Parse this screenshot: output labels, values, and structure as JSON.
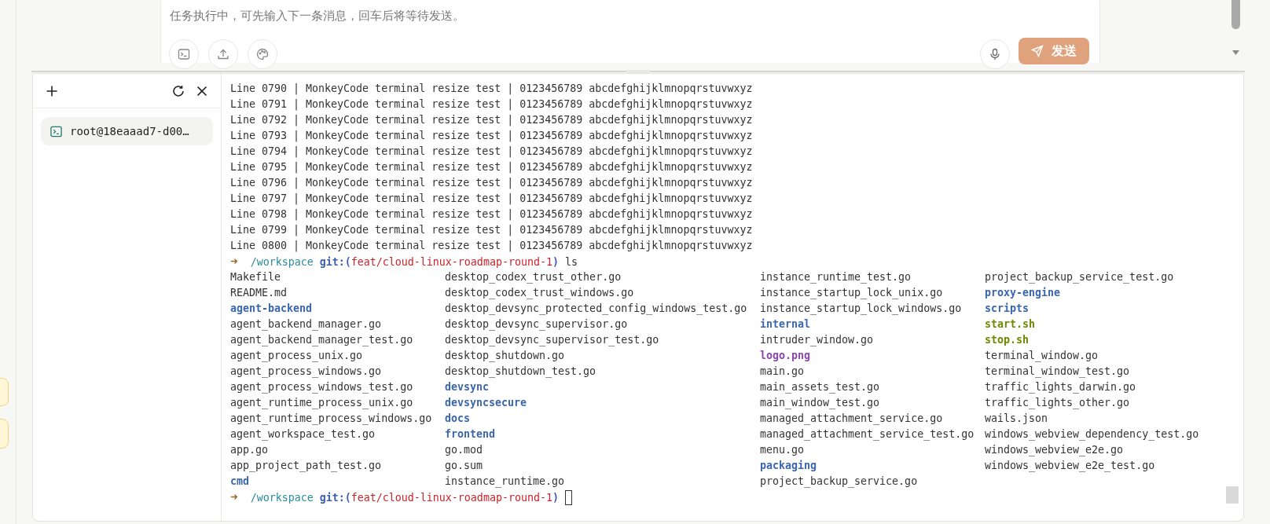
{
  "composer": {
    "placeholder": "任务执行中，可先输入下一条消息，回车后将等待发送。",
    "send_button": "发送"
  },
  "terminal": {
    "sessions": [
      {
        "label": "root@18eaaad7-d00…",
        "selected": true
      }
    ],
    "lines": [
      {
        "kind": "output",
        "text": "Line 0790 | MonkeyCode terminal resize test | 0123456789 abcdefghijklmnopqrstuvwxyz"
      },
      {
        "kind": "output",
        "text": "Line 0791 | MonkeyCode terminal resize test | 0123456789 abcdefghijklmnopqrstuvwxyz"
      },
      {
        "kind": "output",
        "text": "Line 0792 | MonkeyCode terminal resize test | 0123456789 abcdefghijklmnopqrstuvwxyz"
      },
      {
        "kind": "output",
        "text": "Line 0793 | MonkeyCode terminal resize test | 0123456789 abcdefghijklmnopqrstuvwxyz"
      },
      {
        "kind": "output",
        "text": "Line 0794 | MonkeyCode terminal resize test | 0123456789 abcdefghijklmnopqrstuvwxyz"
      },
      {
        "kind": "output",
        "text": "Line 0795 | MonkeyCode terminal resize test | 0123456789 abcdefghijklmnopqrstuvwxyz"
      },
      {
        "kind": "output",
        "text": "Line 0796 | MonkeyCode terminal resize test | 0123456789 abcdefghijklmnopqrstuvwxyz"
      },
      {
        "kind": "output",
        "text": "Line 0797 | MonkeyCode terminal resize test | 0123456789 abcdefghijklmnopqrstuvwxyz"
      },
      {
        "kind": "output",
        "text": "Line 0798 | MonkeyCode terminal resize test | 0123456789 abcdefghijklmnopqrstuvwxyz"
      },
      {
        "kind": "output",
        "text": "Line 0799 | MonkeyCode terminal resize test | 0123456789 abcdefghijklmnopqrstuvwxyz"
      },
      {
        "kind": "output",
        "text": "Line 0800 | MonkeyCode terminal resize test | 0123456789 abcdefghijklmnopqrstuvwxyz"
      },
      {
        "kind": "prompt",
        "arrow": "➜",
        "path": "/workspace",
        "git": "git:(",
        "branch": "feat/cloud-linux-roadmap-round-1",
        "git_close": ")",
        "command": "ls"
      },
      {
        "kind": "listing",
        "columns": [
          [
            {
              "name": "Makefile",
              "kind": "file"
            },
            {
              "name": "README.md",
              "kind": "file"
            },
            {
              "name": "agent-backend",
              "kind": "dir"
            },
            {
              "name": "agent_backend_manager.go",
              "kind": "file"
            },
            {
              "name": "agent_backend_manager_test.go",
              "kind": "file"
            },
            {
              "name": "agent_process_unix.go",
              "kind": "file"
            },
            {
              "name": "agent_process_windows.go",
              "kind": "file"
            },
            {
              "name": "agent_process_windows_test.go",
              "kind": "file"
            },
            {
              "name": "agent_runtime_process_unix.go",
              "kind": "file"
            },
            {
              "name": "agent_runtime_process_windows.go",
              "kind": "file"
            },
            {
              "name": "agent_workspace_test.go",
              "kind": "file"
            },
            {
              "name": "app.go",
              "kind": "file"
            },
            {
              "name": "app_project_path_test.go",
              "kind": "file"
            },
            {
              "name": "cmd",
              "kind": "dir"
            }
          ],
          [
            {
              "name": "desktop_codex_trust_other.go",
              "kind": "file"
            },
            {
              "name": "desktop_codex_trust_windows.go",
              "kind": "file"
            },
            {
              "name": "desktop_devsync_protected_config_windows_test.go",
              "kind": "file"
            },
            {
              "name": "desktop_devsync_supervisor.go",
              "kind": "file"
            },
            {
              "name": "desktop_devsync_supervisor_test.go",
              "kind": "file"
            },
            {
              "name": "desktop_shutdown.go",
              "kind": "file"
            },
            {
              "name": "desktop_shutdown_test.go",
              "kind": "file"
            },
            {
              "name": "devsync",
              "kind": "dir"
            },
            {
              "name": "devsyncsecure",
              "kind": "dir"
            },
            {
              "name": "docs",
              "kind": "dir"
            },
            {
              "name": "frontend",
              "kind": "dir"
            },
            {
              "name": "go.mod",
              "kind": "file"
            },
            {
              "name": "go.sum",
              "kind": "file"
            },
            {
              "name": "instance_runtime.go",
              "kind": "file"
            }
          ],
          [
            {
              "name": "instance_runtime_test.go",
              "kind": "file"
            },
            {
              "name": "instance_startup_lock_unix.go",
              "kind": "file"
            },
            {
              "name": "instance_startup_lock_windows.go",
              "kind": "file"
            },
            {
              "name": "internal",
              "kind": "dir"
            },
            {
              "name": "intruder_window.go",
              "kind": "file"
            },
            {
              "name": "logo.png",
              "kind": "image"
            },
            {
              "name": "main.go",
              "kind": "file"
            },
            {
              "name": "main_assets_test.go",
              "kind": "file"
            },
            {
              "name": "main_window_test.go",
              "kind": "file"
            },
            {
              "name": "managed_attachment_service.go",
              "kind": "file"
            },
            {
              "name": "managed_attachment_service_test.go",
              "kind": "file"
            },
            {
              "name": "menu.go",
              "kind": "file"
            },
            {
              "name": "packaging",
              "kind": "dir"
            },
            {
              "name": "project_backup_service.go",
              "kind": "file"
            }
          ],
          [
            {
              "name": "project_backup_service_test.go",
              "kind": "file"
            },
            {
              "name": "proxy-engine",
              "kind": "dir"
            },
            {
              "name": "scripts",
              "kind": "dir"
            },
            {
              "name": "start.sh",
              "kind": "exec"
            },
            {
              "name": "stop.sh",
              "kind": "exec"
            },
            {
              "name": "terminal_window.go",
              "kind": "file"
            },
            {
              "name": "terminal_window_test.go",
              "kind": "file"
            },
            {
              "name": "traffic_lights_darwin.go",
              "kind": "file"
            },
            {
              "name": "traffic_lights_other.go",
              "kind": "file"
            },
            {
              "name": "wails.json",
              "kind": "file"
            },
            {
              "name": "windows_webview_dependency_test.go",
              "kind": "file"
            },
            {
              "name": "windows_webview_e2e.go",
              "kind": "file"
            },
            {
              "name": "windows_webview_e2e_test.go",
              "kind": "file"
            }
          ]
        ]
      },
      {
        "kind": "prompt",
        "arrow": "➜",
        "path": "/workspace",
        "git": "git:(",
        "branch": "feat/cloud-linux-roadmap-round-1",
        "git_close": ")",
        "cursor": true
      }
    ]
  }
}
